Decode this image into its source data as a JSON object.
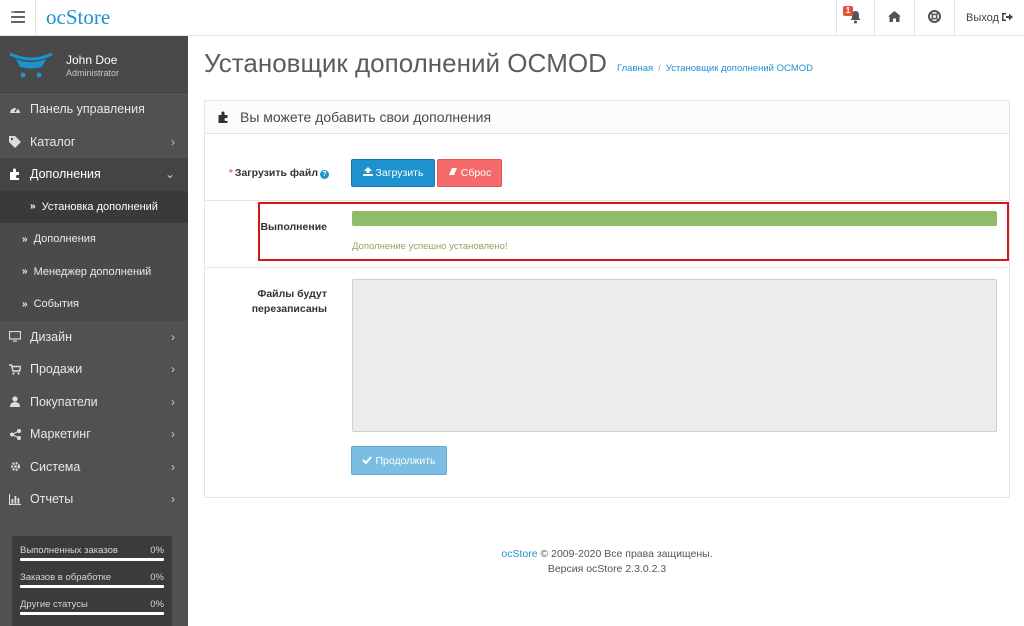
{
  "header": {
    "logo_text": "ocStore",
    "notifications_count": "1",
    "logout_label": "Выход"
  },
  "sidebar": {
    "profile": {
      "name": "John Doe",
      "role": "Administrator"
    },
    "items": [
      {
        "label": "Панель управления",
        "icon": "dashboard-icon"
      },
      {
        "label": "Каталог",
        "icon": "tag-icon"
      },
      {
        "label": "Дополнения",
        "icon": "puzzle-icon"
      },
      {
        "label": "Дизайн",
        "icon": "monitor-icon"
      },
      {
        "label": "Продажи",
        "icon": "cart-icon"
      },
      {
        "label": "Покупатели",
        "icon": "user-icon"
      },
      {
        "label": "Маркетинг",
        "icon": "share-icon"
      },
      {
        "label": "Система",
        "icon": "cog-icon"
      },
      {
        "label": "Отчеты",
        "icon": "bar-chart-icon"
      }
    ],
    "subitems": [
      {
        "label": "Установка дополнений"
      },
      {
        "label": "Дополнения"
      },
      {
        "label": "Менеджер дополнений"
      },
      {
        "label": "События"
      }
    ],
    "stats": [
      {
        "label": "Выполненных заказов",
        "value": "0%",
        "progress": 0
      },
      {
        "label": "Заказов в обработке",
        "value": "0%",
        "progress": 0
      },
      {
        "label": "Другие статусы",
        "value": "0%",
        "progress": 0
      }
    ]
  },
  "page": {
    "title": "Установщик дополнений OCMOD",
    "breadcrumb": [
      "Главная",
      "Установщик дополнений OCMOD"
    ]
  },
  "panel": {
    "heading": "Вы можете добавить свои дополнения",
    "upload_label": "Загрузить файл",
    "upload_button": "Загрузить",
    "reset_button": "Сброс",
    "progress_label": "Выполнение",
    "progress_value": 100,
    "progress_message": "Дополнение успешно установлено!",
    "overwrite_label_line1": "Файлы будут",
    "overwrite_label_line2": "перезаписаны",
    "overwrite_value": "",
    "continue_button": "Продолжить"
  },
  "footer": {
    "link": "ocStore",
    "copyright": "© 2009-2020 Все права защищены.",
    "version": "Версия ocStore 2.3.0.2.3"
  },
  "colors": {
    "accent": "#1e91cf",
    "danger": "#f56b6b",
    "success": "#8fbd67",
    "sidebar": "#515151",
    "highlight": "#d9141b"
  }
}
